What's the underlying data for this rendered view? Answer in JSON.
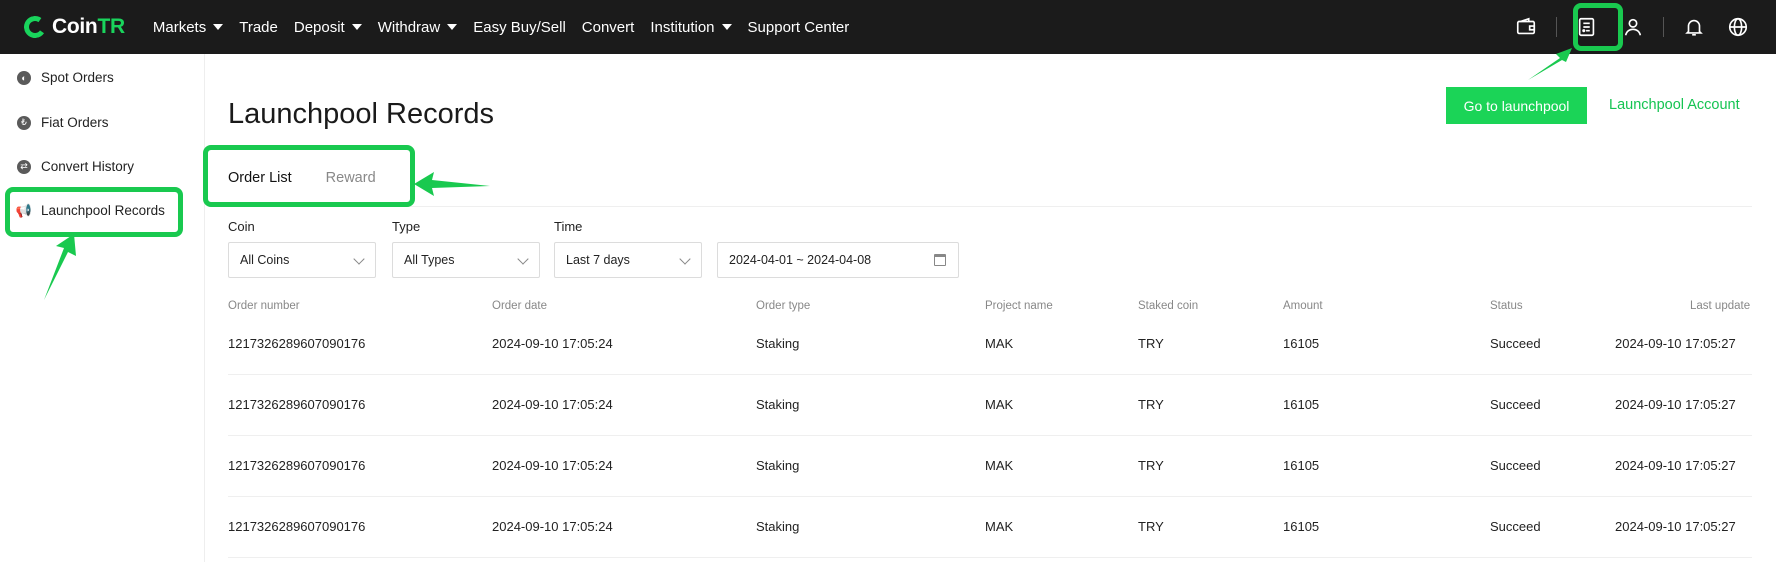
{
  "brand": {
    "name_a": "Coin",
    "name_b": "TR",
    "accent": "#19d45c"
  },
  "nav": {
    "items": [
      {
        "label": "Markets",
        "dropdown": true
      },
      {
        "label": "Trade",
        "dropdown": false
      },
      {
        "label": "Deposit",
        "dropdown": true
      },
      {
        "label": "Withdraw",
        "dropdown": true
      },
      {
        "label": "Easy Buy/Sell",
        "dropdown": false
      },
      {
        "label": "Convert",
        "dropdown": false
      },
      {
        "label": "Institution",
        "dropdown": true
      },
      {
        "label": "Support Center",
        "dropdown": false
      }
    ],
    "icons": [
      "wallet-icon",
      "orders-icon",
      "user-icon",
      "bell-icon",
      "globe-icon"
    ]
  },
  "sidebar": {
    "items": [
      {
        "label": "Spot Orders",
        "icon": "spot-orders-icon"
      },
      {
        "label": "Fiat Orders",
        "icon": "fiat-orders-icon"
      },
      {
        "label": "Convert History",
        "icon": "convert-history-icon"
      },
      {
        "label": "Launchpool Records",
        "icon": "megaphone-icon"
      }
    ]
  },
  "main": {
    "title": "Launchpool Records",
    "go_button": "Go to launchpool",
    "account_link": "Launchpool Account",
    "tabs": [
      {
        "label": "Order List"
      },
      {
        "label": "Reward"
      }
    ]
  },
  "filters": {
    "coin": {
      "label": "Coin",
      "value": "All Coins"
    },
    "type": {
      "label": "Type",
      "value": "All Types"
    },
    "time": {
      "label": "Time",
      "value": "Last 7 days"
    },
    "range": {
      "value": "2024-04-01 ~ 2024-04-08"
    }
  },
  "table": {
    "headers": [
      "Order number",
      "Order date",
      "Order type",
      "Project name",
      "Staked coin",
      "Amount",
      "Status",
      "Last update"
    ],
    "rows": [
      [
        "1217326289607090176",
        "2024-09-10 17:05:24",
        "Staking",
        "MAK",
        "TRY",
        "16105",
        "Succeed",
        "2024-09-10 17:05:27"
      ],
      [
        "1217326289607090176",
        "2024-09-10 17:05:24",
        "Staking",
        "MAK",
        "TRY",
        "16105",
        "Succeed",
        "2024-09-10 17:05:27"
      ],
      [
        "1217326289607090176",
        "2024-09-10 17:05:24",
        "Staking",
        "MAK",
        "TRY",
        "16105",
        "Succeed",
        "2024-09-10 17:05:27"
      ],
      [
        "1217326289607090176",
        "2024-09-10 17:05:24",
        "Staking",
        "MAK",
        "TRY",
        "16105",
        "Succeed",
        "2024-09-10 17:05:27"
      ]
    ]
  },
  "colors": {
    "highlight": "#19c94f",
    "button": "#1bd457",
    "link": "#15c452",
    "topbar": "#1b1b1b"
  }
}
